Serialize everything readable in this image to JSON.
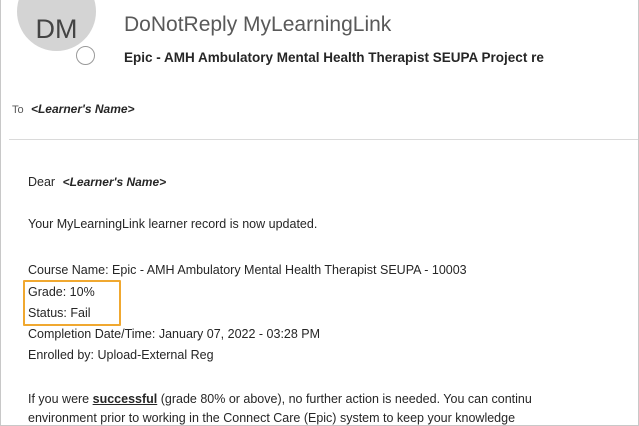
{
  "header": {
    "avatar_initials": "DM",
    "sender": "DoNotReply MyLearningLink",
    "subject": "Epic - AMH Ambulatory Mental Health Therapist SEUPA Project re"
  },
  "recipients": {
    "to_label": "To",
    "to_value": "<Learner's Name>"
  },
  "body": {
    "greeting": "Dear",
    "greeting_name": "<Learner's Name>",
    "intro": "Your MyLearningLink learner record is now updated.",
    "course_line": "Course Name: Epic - AMH Ambulatory Mental Health Therapist SEUPA - 10003",
    "grade_line": "Grade: 10%",
    "status_line": "Status: Fail",
    "completion_line": "Completion Date/Time: January 07, 2022 - 03:28 PM",
    "enrolled_line": "Enrolled by: Upload-External Reg",
    "paragraph_prefix": "If you were ",
    "paragraph_bold": "successful",
    "paragraph_suffix": " (grade 80% or above), no further action is needed. You can continu",
    "paragraph_line2": "environment prior to working in the Connect Care (Epic) system to keep your knowledge"
  },
  "colors": {
    "highlight_border": "#f0a830",
    "avatar_bg": "#d4d4d4"
  }
}
